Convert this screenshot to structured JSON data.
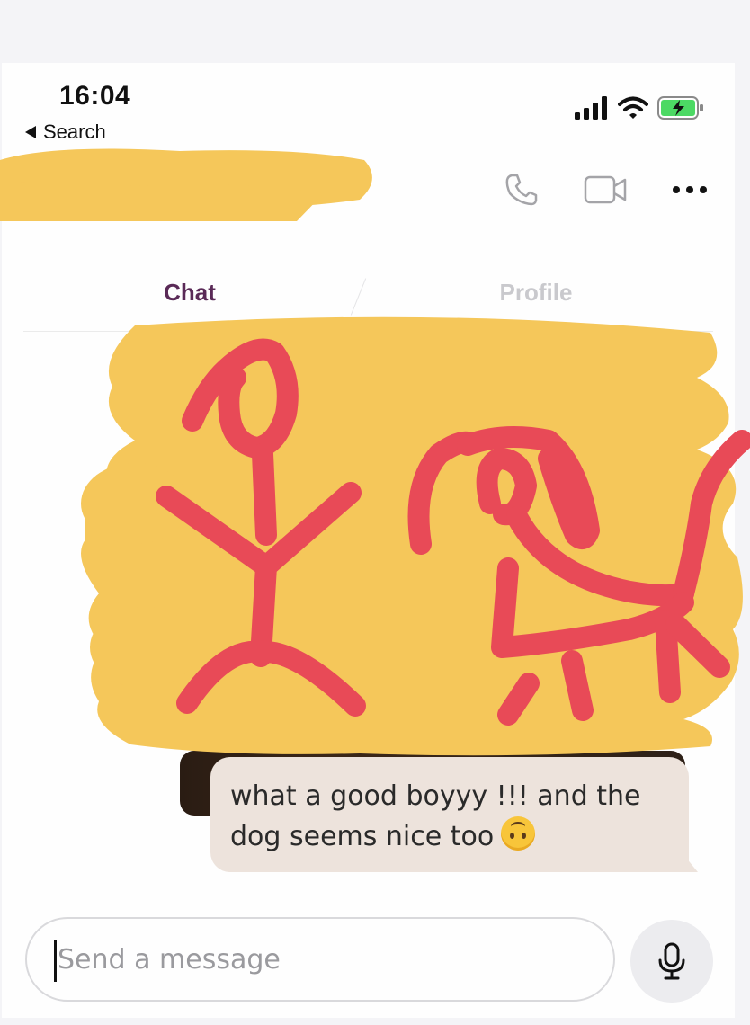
{
  "status_bar": {
    "time": "16:04",
    "back_label": "Search",
    "icons": [
      "signal-icon",
      "wifi-icon",
      "battery-charging-icon"
    ]
  },
  "header": {
    "contact_name": "",
    "actions": [
      "phone-icon",
      "video-camera-icon",
      "more-icon"
    ]
  },
  "tabs": [
    {
      "label": "Chat",
      "active": true
    },
    {
      "label": "Profile",
      "active": false
    }
  ],
  "messages": [
    {
      "text": "what a good boyyy !!! and the dog seems nice too",
      "emoji": "upside-down-face-icon",
      "side": "right"
    }
  ],
  "composer": {
    "placeholder": "Send a message",
    "value": ""
  },
  "colors": {
    "accent": "#5a2a57",
    "scribble_yellow": "#f5c75a",
    "scribble_red": "#e84a57",
    "bubble": "#ede3dc"
  }
}
